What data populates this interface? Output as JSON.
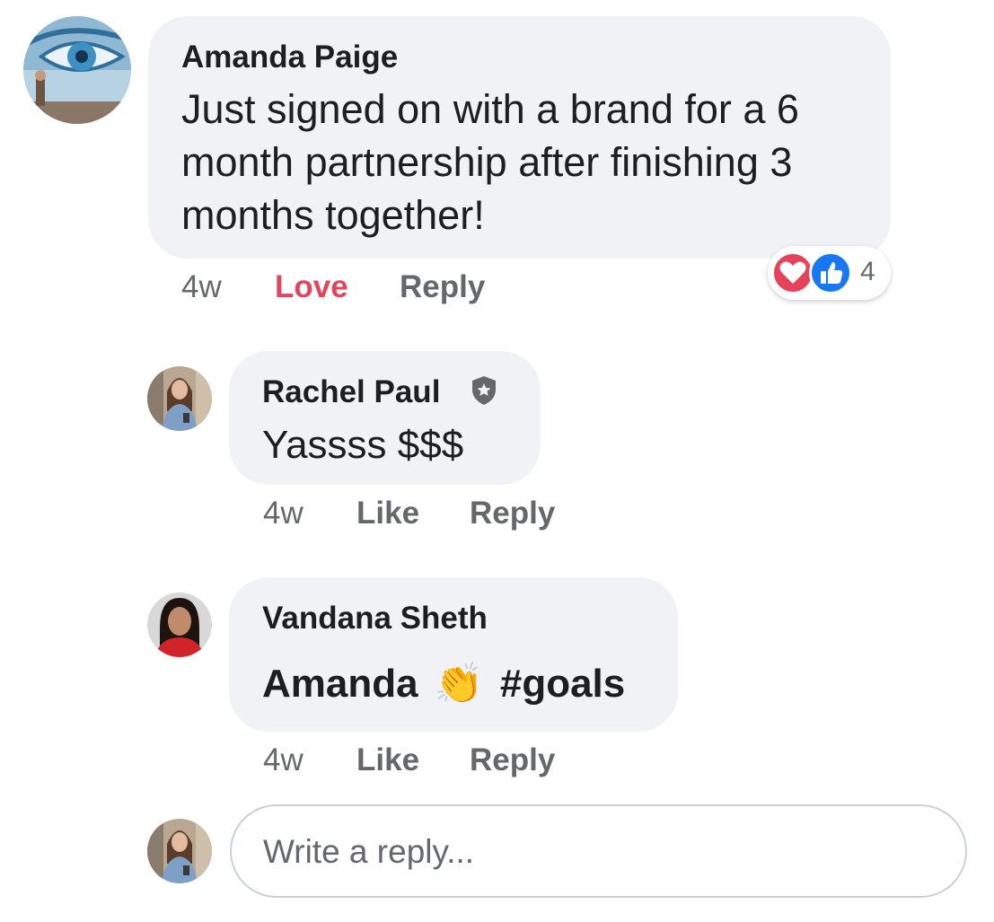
{
  "comments": [
    {
      "author": "Amanda Paige",
      "text": "Just signed on with a brand for a 6 month partnership after finishing 3 months together!",
      "time": "4w",
      "reaction_action": "Love",
      "reply_label": "Reply",
      "reaction_count": "4",
      "reactions": [
        "heart-icon",
        "thumbs-up-icon"
      ]
    },
    {
      "author": "Rachel Paul",
      "badge": "admin-shield-icon",
      "text": "Yassss $$$",
      "time": "4w",
      "like_label": "Like",
      "reply_label": "Reply"
    },
    {
      "author": "Vandana Sheth",
      "text_before": "Amanda",
      "emoji": "👏",
      "text_after": "#goals",
      "time": "4w",
      "like_label": "Like",
      "reply_label": "Reply"
    }
  ],
  "composer": {
    "placeholder": "Write a reply..."
  },
  "colors": {
    "bubble": "#f0f2f5",
    "meta_text": "#65676b",
    "love": "#e0475e",
    "like_blue": "#1877f2"
  }
}
